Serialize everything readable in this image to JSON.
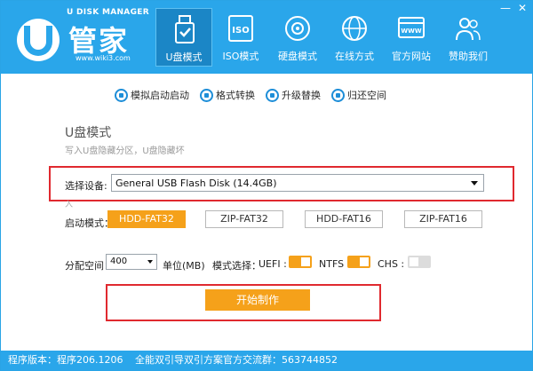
{
  "window": {
    "controls": [
      "—",
      "✕"
    ]
  },
  "logo": {
    "en": "U DISK MANAGER",
    "cn": "管家",
    "url": "www.wiki3.com"
  },
  "nav": [
    {
      "label": "U盘模式",
      "icon": "usb-drive-icon",
      "active": true
    },
    {
      "label": "ISO模式",
      "icon": "iso-disc-icon",
      "active": false
    },
    {
      "label": "硬盘模式",
      "icon": "hard-disk-icon",
      "active": false
    },
    {
      "label": "在线方式",
      "icon": "globe-icon",
      "active": false
    },
    {
      "label": "官方网站",
      "icon": "website-icon",
      "active": false
    },
    {
      "label": "赞助我们",
      "icon": "people-icon",
      "active": false
    }
  ],
  "toolbar": [
    {
      "label": "模拟启动启动",
      "icon": "simulate-icon"
    },
    {
      "label": "格式转换",
      "icon": "convert-icon"
    },
    {
      "label": "升级替换",
      "icon": "upgrade-icon"
    },
    {
      "label": "归还空间",
      "icon": "restore-icon"
    }
  ],
  "mode": {
    "title": "U盘模式",
    "desc": "写入U盘隐藏分区，U盘隐藏坏"
  },
  "device": {
    "label": "选择设备:",
    "value": "General USB Flash Disk (14.4GB)",
    "hint": "入"
  },
  "boot": {
    "label": "启动模式：",
    "options": [
      "HDD-FAT32",
      "ZIP-FAT32",
      "HDD-FAT16",
      "ZIP-FAT16"
    ],
    "selected": 0
  },
  "alloc": {
    "label": "分配空间：",
    "value": "400",
    "unit": "单位(MB)",
    "mode_label": "模式选择：",
    "options": [
      {
        "label": "UEFI :",
        "on": true
      },
      {
        "label": "NTFS",
        "on": true
      },
      {
        "label": "CHS :",
        "on": false
      }
    ]
  },
  "start": {
    "label": "开始制作"
  },
  "status": {
    "version": "程序版本：程序206.1206",
    "group": "全能双引导双引方案官方交流群：563744852"
  },
  "colors": {
    "header": "#2aa6ea",
    "accent": "#f5a11a",
    "highlight": "#e0292f"
  }
}
